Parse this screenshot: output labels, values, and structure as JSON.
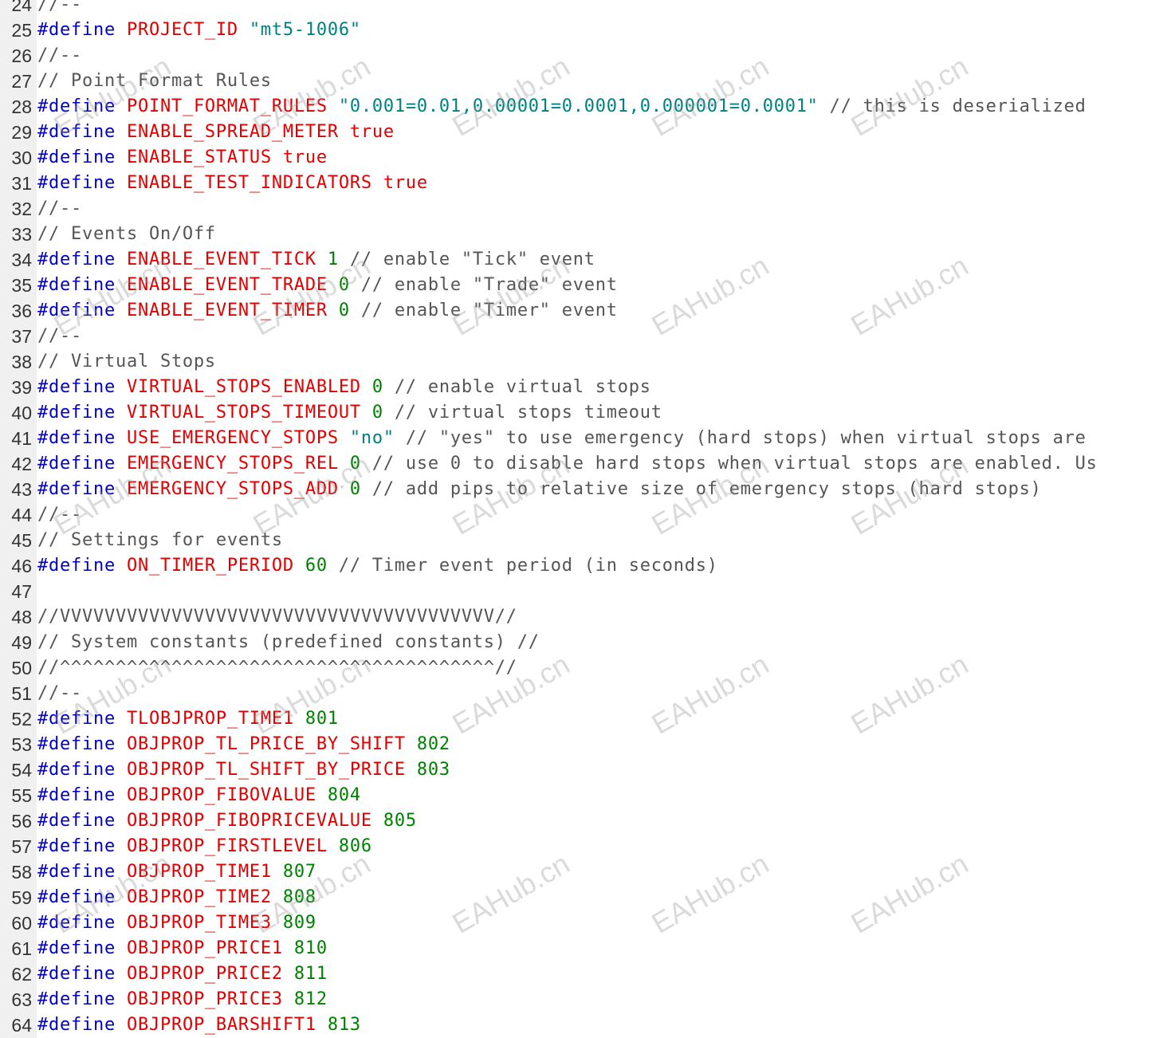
{
  "editor": {
    "lines": [
      {
        "n": "24",
        "tokens": [
          {
            "t": "cm",
            "v": "//--"
          }
        ]
      },
      {
        "n": "25",
        "tokens": [
          {
            "t": "pp",
            "v": "#define "
          },
          {
            "t": "mac",
            "v": "PROJECT_ID"
          },
          {
            "t": "txt",
            "v": " "
          },
          {
            "t": "str",
            "v": "\"mt5-1006\""
          }
        ]
      },
      {
        "n": "26",
        "tokens": [
          {
            "t": "cm",
            "v": "//--"
          }
        ]
      },
      {
        "n": "27",
        "tokens": [
          {
            "t": "cm",
            "v": "// Point Format Rules"
          }
        ]
      },
      {
        "n": "28",
        "tokens": [
          {
            "t": "pp",
            "v": "#define "
          },
          {
            "t": "mac",
            "v": "POINT_FORMAT_RULES"
          },
          {
            "t": "txt",
            "v": " "
          },
          {
            "t": "str",
            "v": "\"0.001=0.01,0.00001=0.0001,0.000001=0.0001\""
          },
          {
            "t": "cm",
            "v": " // this is deserialized"
          }
        ]
      },
      {
        "n": "29",
        "tokens": [
          {
            "t": "pp",
            "v": "#define "
          },
          {
            "t": "mac",
            "v": "ENABLE_SPREAD_METER"
          },
          {
            "t": "txt",
            "v": " "
          },
          {
            "t": "bool",
            "v": "true"
          }
        ]
      },
      {
        "n": "30",
        "tokens": [
          {
            "t": "pp",
            "v": "#define "
          },
          {
            "t": "mac",
            "v": "ENABLE_STATUS"
          },
          {
            "t": "txt",
            "v": " "
          },
          {
            "t": "bool",
            "v": "true"
          }
        ]
      },
      {
        "n": "31",
        "tokens": [
          {
            "t": "pp",
            "v": "#define "
          },
          {
            "t": "mac",
            "v": "ENABLE_TEST_INDICATORS"
          },
          {
            "t": "txt",
            "v": " "
          },
          {
            "t": "bool",
            "v": "true"
          }
        ]
      },
      {
        "n": "32",
        "tokens": [
          {
            "t": "cm",
            "v": "//--"
          }
        ]
      },
      {
        "n": "33",
        "tokens": [
          {
            "t": "cm",
            "v": "// Events On/Off"
          }
        ]
      },
      {
        "n": "34",
        "tokens": [
          {
            "t": "pp",
            "v": "#define "
          },
          {
            "t": "mac",
            "v": "ENABLE_EVENT_TICK"
          },
          {
            "t": "txt",
            "v": " "
          },
          {
            "t": "num",
            "v": "1"
          },
          {
            "t": "cm",
            "v": " // enable \"Tick\" event"
          }
        ]
      },
      {
        "n": "35",
        "tokens": [
          {
            "t": "pp",
            "v": "#define "
          },
          {
            "t": "mac",
            "v": "ENABLE_EVENT_TRADE"
          },
          {
            "t": "txt",
            "v": " "
          },
          {
            "t": "num",
            "v": "0"
          },
          {
            "t": "cm",
            "v": " // enable \"Trade\" event"
          }
        ]
      },
      {
        "n": "36",
        "tokens": [
          {
            "t": "pp",
            "v": "#define "
          },
          {
            "t": "mac",
            "v": "ENABLE_EVENT_TIMER"
          },
          {
            "t": "txt",
            "v": " "
          },
          {
            "t": "num",
            "v": "0"
          },
          {
            "t": "cm",
            "v": " // enable \"Timer\" event"
          }
        ]
      },
      {
        "n": "37",
        "tokens": [
          {
            "t": "cm",
            "v": "//--"
          }
        ]
      },
      {
        "n": "38",
        "tokens": [
          {
            "t": "cm",
            "v": "// Virtual Stops"
          }
        ]
      },
      {
        "n": "39",
        "tokens": [
          {
            "t": "pp",
            "v": "#define "
          },
          {
            "t": "mac",
            "v": "VIRTUAL_STOPS_ENABLED"
          },
          {
            "t": "txt",
            "v": " "
          },
          {
            "t": "num",
            "v": "0"
          },
          {
            "t": "cm",
            "v": " // enable virtual stops"
          }
        ]
      },
      {
        "n": "40",
        "tokens": [
          {
            "t": "pp",
            "v": "#define "
          },
          {
            "t": "mac",
            "v": "VIRTUAL_STOPS_TIMEOUT"
          },
          {
            "t": "txt",
            "v": " "
          },
          {
            "t": "num",
            "v": "0"
          },
          {
            "t": "cm",
            "v": " // virtual stops timeout"
          }
        ]
      },
      {
        "n": "41",
        "tokens": [
          {
            "t": "pp",
            "v": "#define "
          },
          {
            "t": "mac",
            "v": "USE_EMERGENCY_STOPS"
          },
          {
            "t": "txt",
            "v": " "
          },
          {
            "t": "str",
            "v": "\"no\""
          },
          {
            "t": "cm",
            "v": " // \"yes\" to use emergency (hard stops) when virtual stops are"
          }
        ]
      },
      {
        "n": "42",
        "tokens": [
          {
            "t": "pp",
            "v": "#define "
          },
          {
            "t": "mac",
            "v": "EMERGENCY_STOPS_REL"
          },
          {
            "t": "txt",
            "v": " "
          },
          {
            "t": "num",
            "v": "0"
          },
          {
            "t": "cm",
            "v": " // use 0 to disable hard stops when virtual stops are enabled. Us"
          }
        ]
      },
      {
        "n": "43",
        "tokens": [
          {
            "t": "pp",
            "v": "#define "
          },
          {
            "t": "mac",
            "v": "EMERGENCY_STOPS_ADD"
          },
          {
            "t": "txt",
            "v": " "
          },
          {
            "t": "num",
            "v": "0"
          },
          {
            "t": "cm",
            "v": " // add pips to relative size of emergency stops (hard stops)"
          }
        ]
      },
      {
        "n": "44",
        "tokens": [
          {
            "t": "cm",
            "v": "//--"
          }
        ]
      },
      {
        "n": "45",
        "tokens": [
          {
            "t": "cm",
            "v": "// Settings for events"
          }
        ]
      },
      {
        "n": "46",
        "tokens": [
          {
            "t": "pp",
            "v": "#define "
          },
          {
            "t": "mac",
            "v": "ON_TIMER_PERIOD"
          },
          {
            "t": "txt",
            "v": " "
          },
          {
            "t": "num",
            "v": "60"
          },
          {
            "t": "cm",
            "v": " // Timer event period (in seconds)"
          }
        ]
      },
      {
        "n": "47",
        "tokens": []
      },
      {
        "n": "48",
        "tokens": [
          {
            "t": "cm",
            "v": "//VVVVVVVVVVVVVVVVVVVVVVVVVVVVVVVVVVVVVVV//"
          }
        ]
      },
      {
        "n": "49",
        "tokens": [
          {
            "t": "cm",
            "v": "// System constants (predefined constants) //"
          }
        ]
      },
      {
        "n": "50",
        "tokens": [
          {
            "t": "cm",
            "v": "//^^^^^^^^^^^^^^^^^^^^^^^^^^^^^^^^^^^^^^^//"
          }
        ]
      },
      {
        "n": "51",
        "tokens": [
          {
            "t": "cm",
            "v": "//--"
          }
        ]
      },
      {
        "n": "52",
        "tokens": [
          {
            "t": "pp",
            "v": "#define "
          },
          {
            "t": "mac",
            "v": "TLOBJPROP_TIME1"
          },
          {
            "t": "txt",
            "v": " "
          },
          {
            "t": "num",
            "v": "801"
          }
        ]
      },
      {
        "n": "53",
        "tokens": [
          {
            "t": "pp",
            "v": "#define "
          },
          {
            "t": "mac",
            "v": "OBJPROP_TL_PRICE_BY_SHIFT"
          },
          {
            "t": "txt",
            "v": " "
          },
          {
            "t": "num",
            "v": "802"
          }
        ]
      },
      {
        "n": "54",
        "tokens": [
          {
            "t": "pp",
            "v": "#define "
          },
          {
            "t": "mac",
            "v": "OBJPROP_TL_SHIFT_BY_PRICE"
          },
          {
            "t": "txt",
            "v": " "
          },
          {
            "t": "num",
            "v": "803"
          }
        ]
      },
      {
        "n": "55",
        "tokens": [
          {
            "t": "pp",
            "v": "#define "
          },
          {
            "t": "mac",
            "v": "OBJPROP_FIBOVALUE"
          },
          {
            "t": "txt",
            "v": " "
          },
          {
            "t": "num",
            "v": "804"
          }
        ]
      },
      {
        "n": "56",
        "tokens": [
          {
            "t": "pp",
            "v": "#define "
          },
          {
            "t": "mac",
            "v": "OBJPROP_FIBOPRICEVALUE"
          },
          {
            "t": "txt",
            "v": " "
          },
          {
            "t": "num",
            "v": "805"
          }
        ]
      },
      {
        "n": "57",
        "tokens": [
          {
            "t": "pp",
            "v": "#define "
          },
          {
            "t": "mac",
            "v": "OBJPROP_FIRSTLEVEL"
          },
          {
            "t": "txt",
            "v": " "
          },
          {
            "t": "num",
            "v": "806"
          }
        ]
      },
      {
        "n": "58",
        "tokens": [
          {
            "t": "pp",
            "v": "#define "
          },
          {
            "t": "mac",
            "v": "OBJPROP_TIME1"
          },
          {
            "t": "txt",
            "v": " "
          },
          {
            "t": "num",
            "v": "807"
          }
        ]
      },
      {
        "n": "59",
        "tokens": [
          {
            "t": "pp",
            "v": "#define "
          },
          {
            "t": "mac",
            "v": "OBJPROP_TIME2"
          },
          {
            "t": "txt",
            "v": " "
          },
          {
            "t": "num",
            "v": "808"
          }
        ]
      },
      {
        "n": "60",
        "tokens": [
          {
            "t": "pp",
            "v": "#define "
          },
          {
            "t": "mac",
            "v": "OBJPROP_TIME3"
          },
          {
            "t": "txt",
            "v": " "
          },
          {
            "t": "num",
            "v": "809"
          }
        ]
      },
      {
        "n": "61",
        "tokens": [
          {
            "t": "pp",
            "v": "#define "
          },
          {
            "t": "mac",
            "v": "OBJPROP_PRICE1"
          },
          {
            "t": "txt",
            "v": " "
          },
          {
            "t": "num",
            "v": "810"
          }
        ]
      },
      {
        "n": "62",
        "tokens": [
          {
            "t": "pp",
            "v": "#define "
          },
          {
            "t": "mac",
            "v": "OBJPROP_PRICE2"
          },
          {
            "t": "txt",
            "v": " "
          },
          {
            "t": "num",
            "v": "811"
          }
        ]
      },
      {
        "n": "63",
        "tokens": [
          {
            "t": "pp",
            "v": "#define "
          },
          {
            "t": "mac",
            "v": "OBJPROP_PRICE3"
          },
          {
            "t": "txt",
            "v": " "
          },
          {
            "t": "num",
            "v": "812"
          }
        ]
      },
      {
        "n": "64",
        "tokens": [
          {
            "t": "pp",
            "v": "#define "
          },
          {
            "t": "mac",
            "v": "OBJPROP_BARSHIFT1"
          },
          {
            "t": "txt",
            "v": " "
          },
          {
            "t": "num",
            "v": "813"
          }
        ]
      }
    ]
  },
  "watermark": {
    "text": "EAHub.cn"
  },
  "colors": {
    "preprocessor": "#0000c8",
    "macro": "#e00000",
    "string": "#008080",
    "number": "#008000",
    "comment": "#555555",
    "gutter_bg": "#f0f0f0"
  }
}
